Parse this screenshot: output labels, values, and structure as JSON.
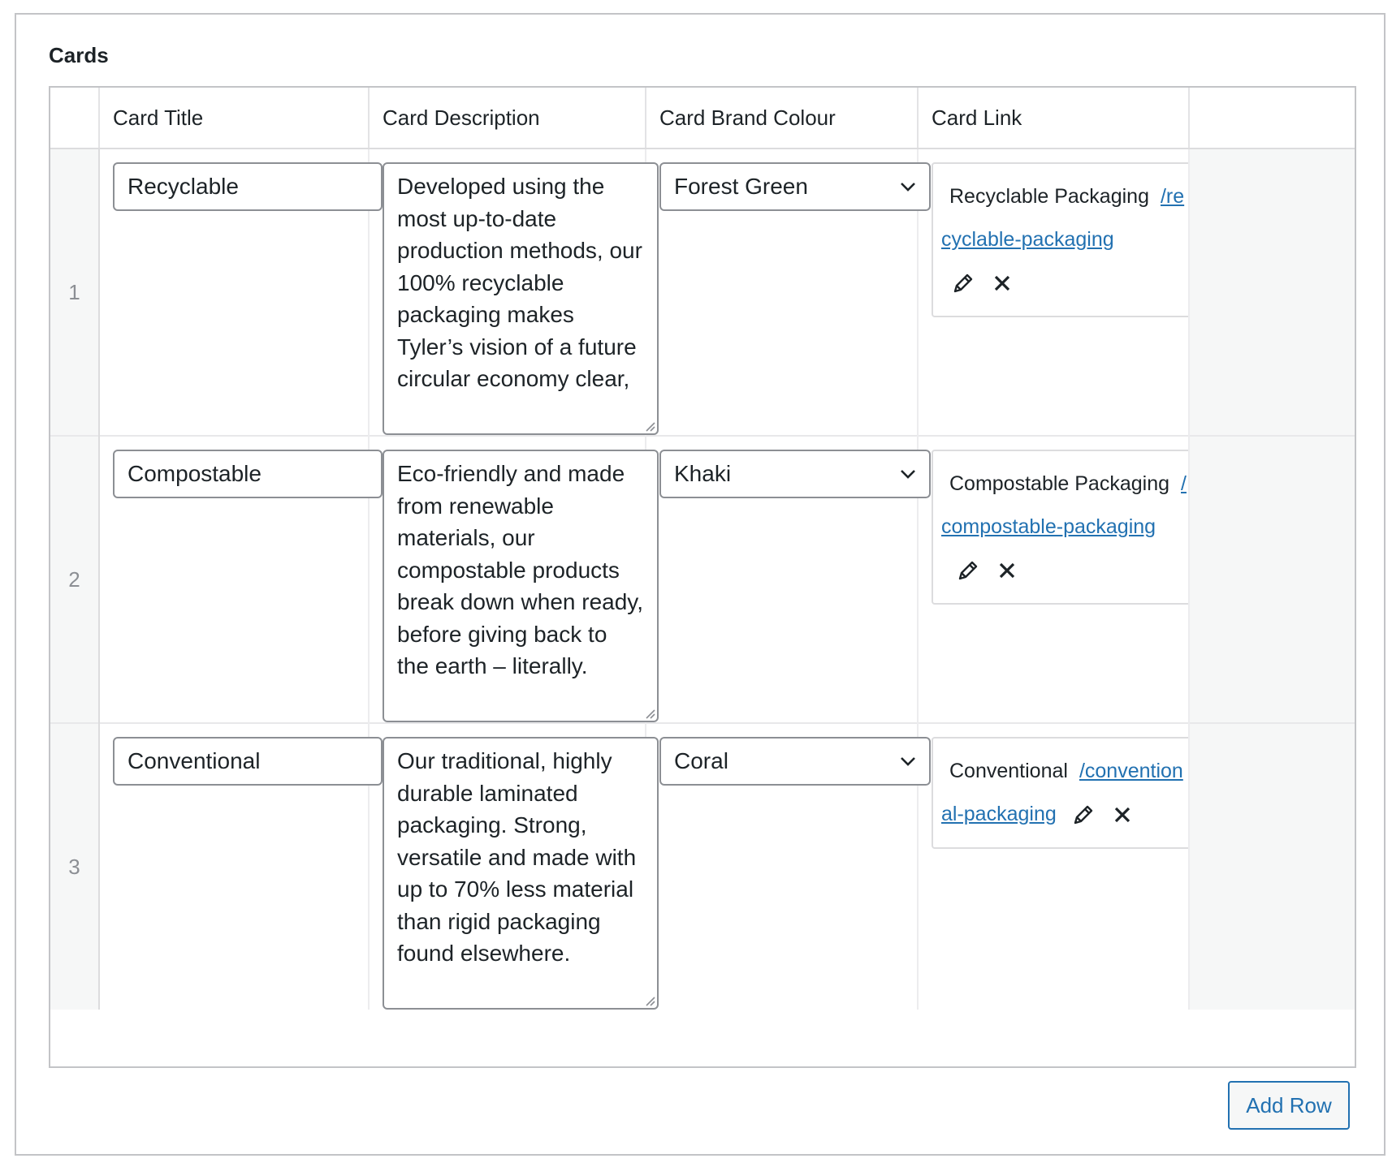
{
  "field": {
    "label": "Cards"
  },
  "table": {
    "headers": [
      "Card Title",
      "Card Description",
      "Card Brand Colour",
      "Card Link"
    ]
  },
  "rows": [
    {
      "order": "1",
      "title": "Recyclable",
      "description": "Developed using the most up-to-date production methods, our 100% recyclable packaging makes Tyler’s vision of a future circular economy clear,",
      "colour": "Forest Green",
      "link": {
        "title": "Recyclable Packaging",
        "url": "/recyclable-packaging"
      }
    },
    {
      "order": "2",
      "title": "Compostable",
      "description": "Eco-friendly and made from renewable materials, our compostable products break down when ready, before giving back to the earth – literally.",
      "colour": "Khaki",
      "link": {
        "title": "Compostable Packaging",
        "url": "/compostable-packaging"
      }
    },
    {
      "order": "3",
      "title": "Conventional",
      "description": "Our traditional, highly durable laminated packaging. Strong, versatile and made with up to 70% less material than rigid packaging found elsewhere.",
      "colour": "Coral",
      "link": {
        "title": "Conventional",
        "url": "/conventional-packaging"
      }
    }
  ],
  "actions": {
    "add_row": "Add Row"
  },
  "icons": {
    "edit": "pencil-icon",
    "remove": "close-icon",
    "dropdown": "chevron-down-icon"
  },
  "colors": {
    "link": "#2271b1",
    "border": "#8c8f94",
    "muted_bg": "#f6f7f7"
  }
}
